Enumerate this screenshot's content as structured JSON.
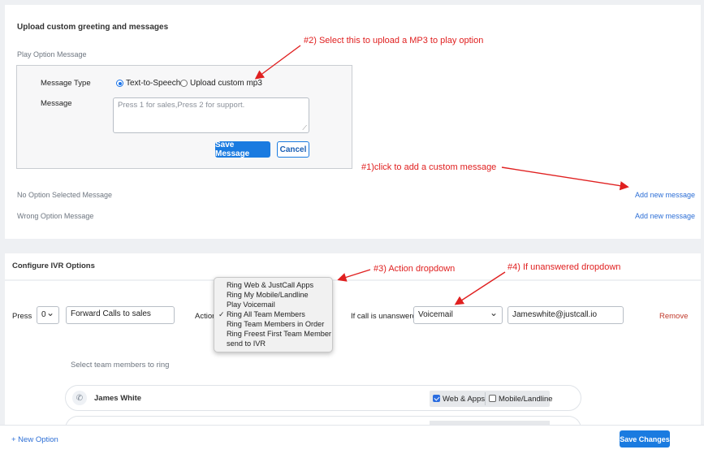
{
  "greeting": {
    "section_title": "Upload custom greeting and messages",
    "play_option_label": "Play Option Message",
    "message_type_label": "Message Type",
    "radio_tts": "Text-to-Speech",
    "radio_mp3": "Upload custom mp3",
    "message_label": "Message",
    "message_placeholder": "Press 1 for sales,Press 2 for support.",
    "save_message": "Save Message",
    "cancel": "Cancel",
    "no_option_label": "No Option Selected Message",
    "wrong_option_label": "Wrong Option Message",
    "add_new_message_1": "Add new message",
    "add_new_message_2": "Add new message"
  },
  "annotations": {
    "a1": "#1)click to  add a custom message",
    "a2": "#2) Select this to upload a MP3 to play option",
    "a3": "#3) Action dropdown",
    "a4": "#4) If unanswered dropdown",
    "color": "#e02020"
  },
  "ivr": {
    "section_title": "Configure IVR Options",
    "press_label": "Press",
    "press_value": "0",
    "description_value": "Forward Calls to sales",
    "action_label": "Action",
    "action_options": [
      "Ring Web & JustCall Apps",
      "Ring My Mobile/Landline",
      "Play Voicemail",
      "Ring All Team Members",
      "Ring Team Members in Order",
      "Ring Freest First Team Member",
      "send to IVR"
    ],
    "action_selected_index": 3,
    "unanswered_label": "If call is unanswerd",
    "unanswered_value": "Voicemail",
    "email_value": "Jameswhite@justcall.io",
    "remove": "Remove",
    "team_label": "Select team members to ring",
    "member_name": "James White",
    "web_apps": "Web & Apps",
    "mobile_landline": "Mobile/Landline"
  },
  "footer": {
    "new_option": "+ New Option",
    "save_changes": "Save Changes"
  },
  "colors": {
    "accent": "#1a7be0",
    "link": "#2d6fd6",
    "remove": "#c0392b"
  }
}
